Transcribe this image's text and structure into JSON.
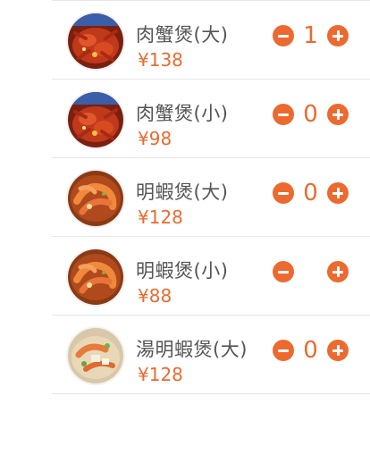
{
  "colors": {
    "accent": "#ec6a2f",
    "name_text": "#555555",
    "divider": "#e6e6e6"
  },
  "dishes": [
    {
      "name": "肉蟹煲(大)",
      "price": "¥138",
      "quantity": "1",
      "image": "crab-pot-image"
    },
    {
      "name": "肉蟹煲(小)",
      "price": "¥98",
      "quantity": "0",
      "image": "crab-pot-image"
    },
    {
      "name": "明蝦煲(大)",
      "price": "¥128",
      "quantity": "0",
      "image": "shrimp-pot-image"
    },
    {
      "name": "明蝦煲(小)",
      "price": "¥88",
      "quantity": "",
      "image": "shrimp-pot-image"
    },
    {
      "name": "湯明蝦煲(大)",
      "price": "¥128",
      "quantity": "0",
      "image": "soup-shrimp-pot-image"
    }
  ]
}
